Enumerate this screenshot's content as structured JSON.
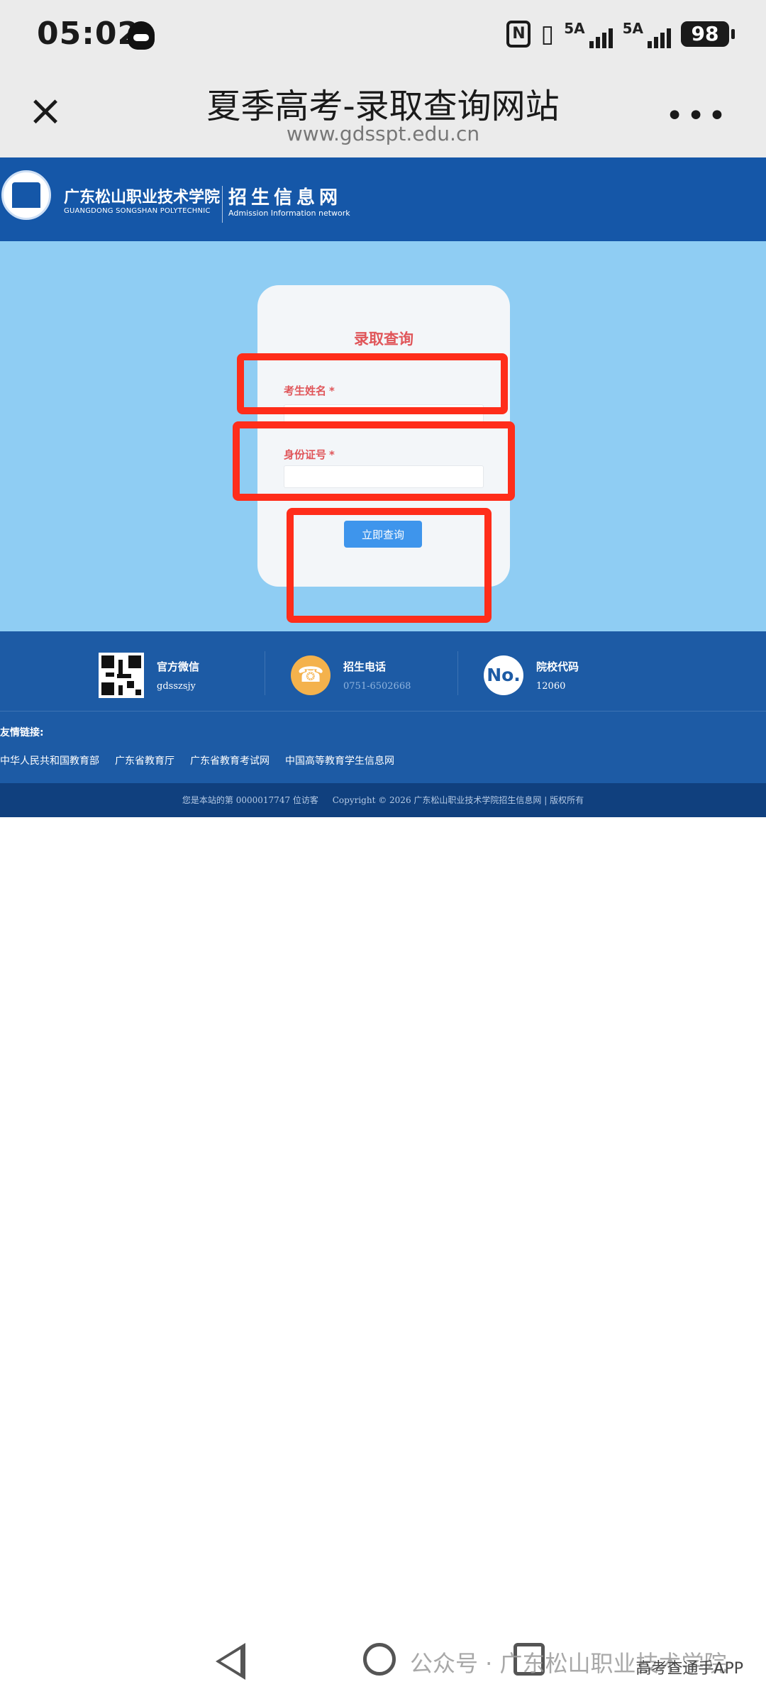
{
  "status_bar": {
    "time": "05:02",
    "signal1_label": "5A",
    "signal2_label": "5A",
    "battery": "98",
    "icons": [
      "qq-icon",
      "nfc-icon",
      "vibrate-icon",
      "signal-icon",
      "battery-icon"
    ]
  },
  "browser": {
    "title": "夏季高考-录取查询网站",
    "url": "www.gdsspt.edu.cn",
    "close_icon": "close-icon",
    "more_icon": "more-icon"
  },
  "site_header": {
    "school_name": "广东松山职业技术学院",
    "school_name_en": "GUANGDONG SONGSHAN POLYTECHNIC",
    "site_name": "招生信息网",
    "site_name_en": "Admission Information network"
  },
  "form": {
    "title": "录取查询",
    "name_label": "考生姓名",
    "id_label": "身份证号",
    "required_mark": "*",
    "name_value": "",
    "id_value": "",
    "submit_label": "立即查询",
    "highlight_color": "#ff2d1a"
  },
  "footer": {
    "wechat_title": "官方微信",
    "wechat_value": "gdsszsjy",
    "phone_title": "招生电话",
    "phone_value": "0751-6502668",
    "code_title": "院校代码",
    "code_value": "12060",
    "code_icon_text": "No.",
    "links_title": "友情链接:",
    "links": [
      "中华人民共和国教育部",
      "广东省教育厅",
      "广东省教育考试网",
      "中国高等教育学生信息网"
    ],
    "visitor_text": "您是本站的第 0000017747 位访客",
    "copyright": "Copyright © 2026  广东松山职业技术学院招生信息网 | 版权所有"
  },
  "nav": {
    "watermark": "公众号 · 广东松山职业技术学院",
    "credit": "高考查通手APP"
  },
  "colors": {
    "header_blue": "#1557a8",
    "main_bg": "#8fcdf3",
    "footer_blue": "#1d5ba5",
    "label_red": "#e0565a",
    "button_blue": "#3e95ec"
  }
}
